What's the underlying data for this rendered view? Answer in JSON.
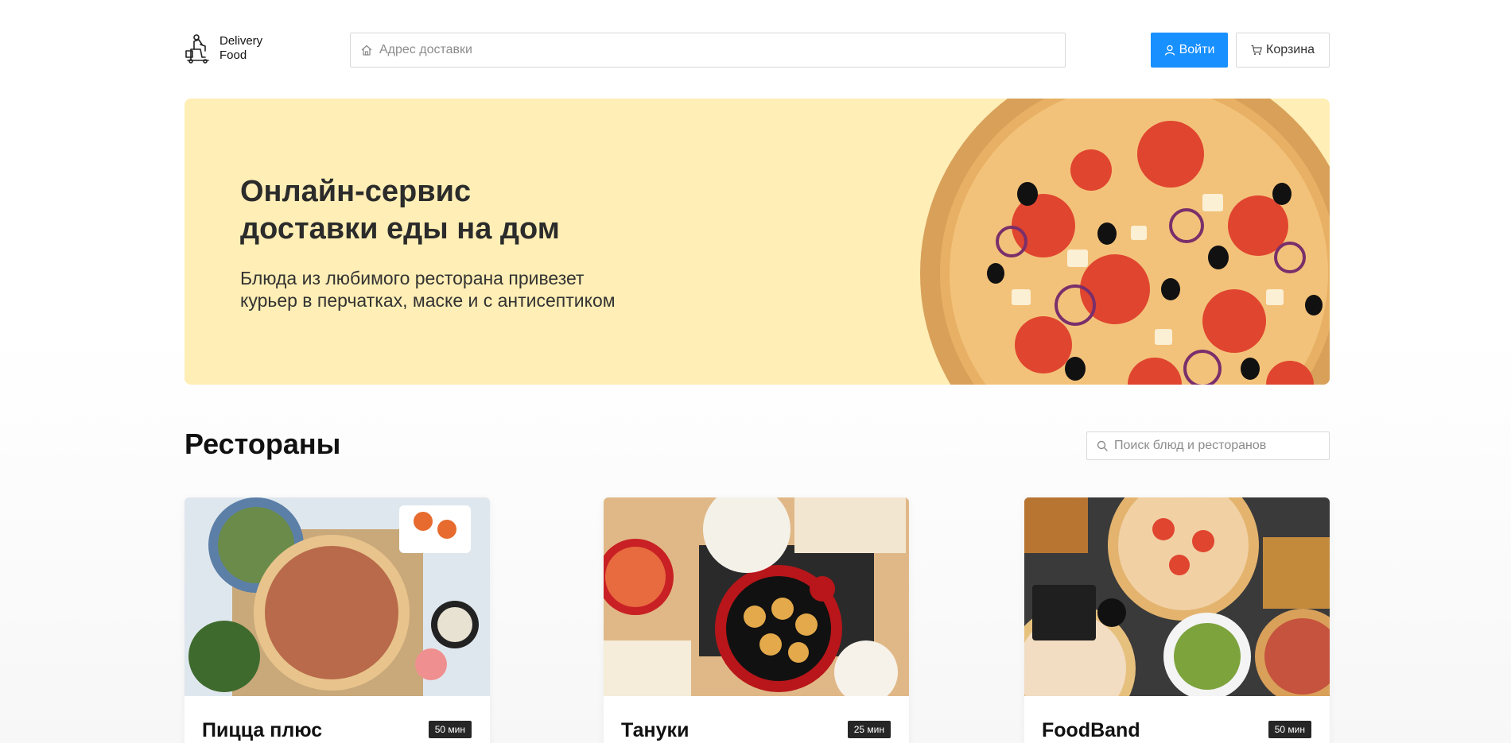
{
  "header": {
    "logo_line1": "Delivery",
    "logo_line2": "Food",
    "address_placeholder": "Адрес доставки",
    "login_label": "Войти",
    "cart_label": "Корзина",
    "accent_color": "#1890ff"
  },
  "promo": {
    "title_line1": "Онлайн-сервис",
    "title_line2": "доставки еды на дом",
    "text_line1": "Блюда из любимого ресторана привезет",
    "text_line2": "курьер в перчатках, маске и с антисептиком",
    "background_color": "#ffeeb5"
  },
  "restaurants": {
    "title": "Рестораны",
    "search_placeholder": "Поиск блюд и ресторанов",
    "cards": [
      {
        "name": "Пицца плюс",
        "time": "50 мин"
      },
      {
        "name": "Тануки",
        "time": "25 мин"
      },
      {
        "name": "FoodBand",
        "time": "50 мин"
      }
    ]
  },
  "icons": [
    "logo-icon",
    "home-icon",
    "user-icon",
    "cart-icon",
    "search-icon"
  ]
}
